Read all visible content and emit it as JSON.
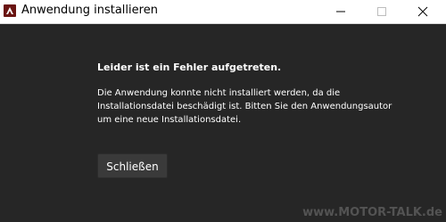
{
  "window": {
    "title": "Anwendung installieren"
  },
  "dialog": {
    "heading": "Leider ist ein Fehler aufgetreten.",
    "message_lines": [
      "Die Anwendung konnte nicht installiert werden, da die",
      "Installationsdatei beschädigt ist. Bitten Sie den Anwendungsautor",
      "um eine neue Installationsdatei."
    ],
    "close_button_label": "Schließen"
  },
  "watermark": "www.MOTOR-TALK.de",
  "icons": {
    "app": "adobe-air-app-icon",
    "minimize": "minimize-icon",
    "maximize": "maximize-icon",
    "close": "close-icon"
  },
  "colors": {
    "background": "#262626",
    "titlebar": "#ffffff",
    "text": "#ffffff",
    "button": "#3a3a3a",
    "app_icon": "#6a1512"
  }
}
